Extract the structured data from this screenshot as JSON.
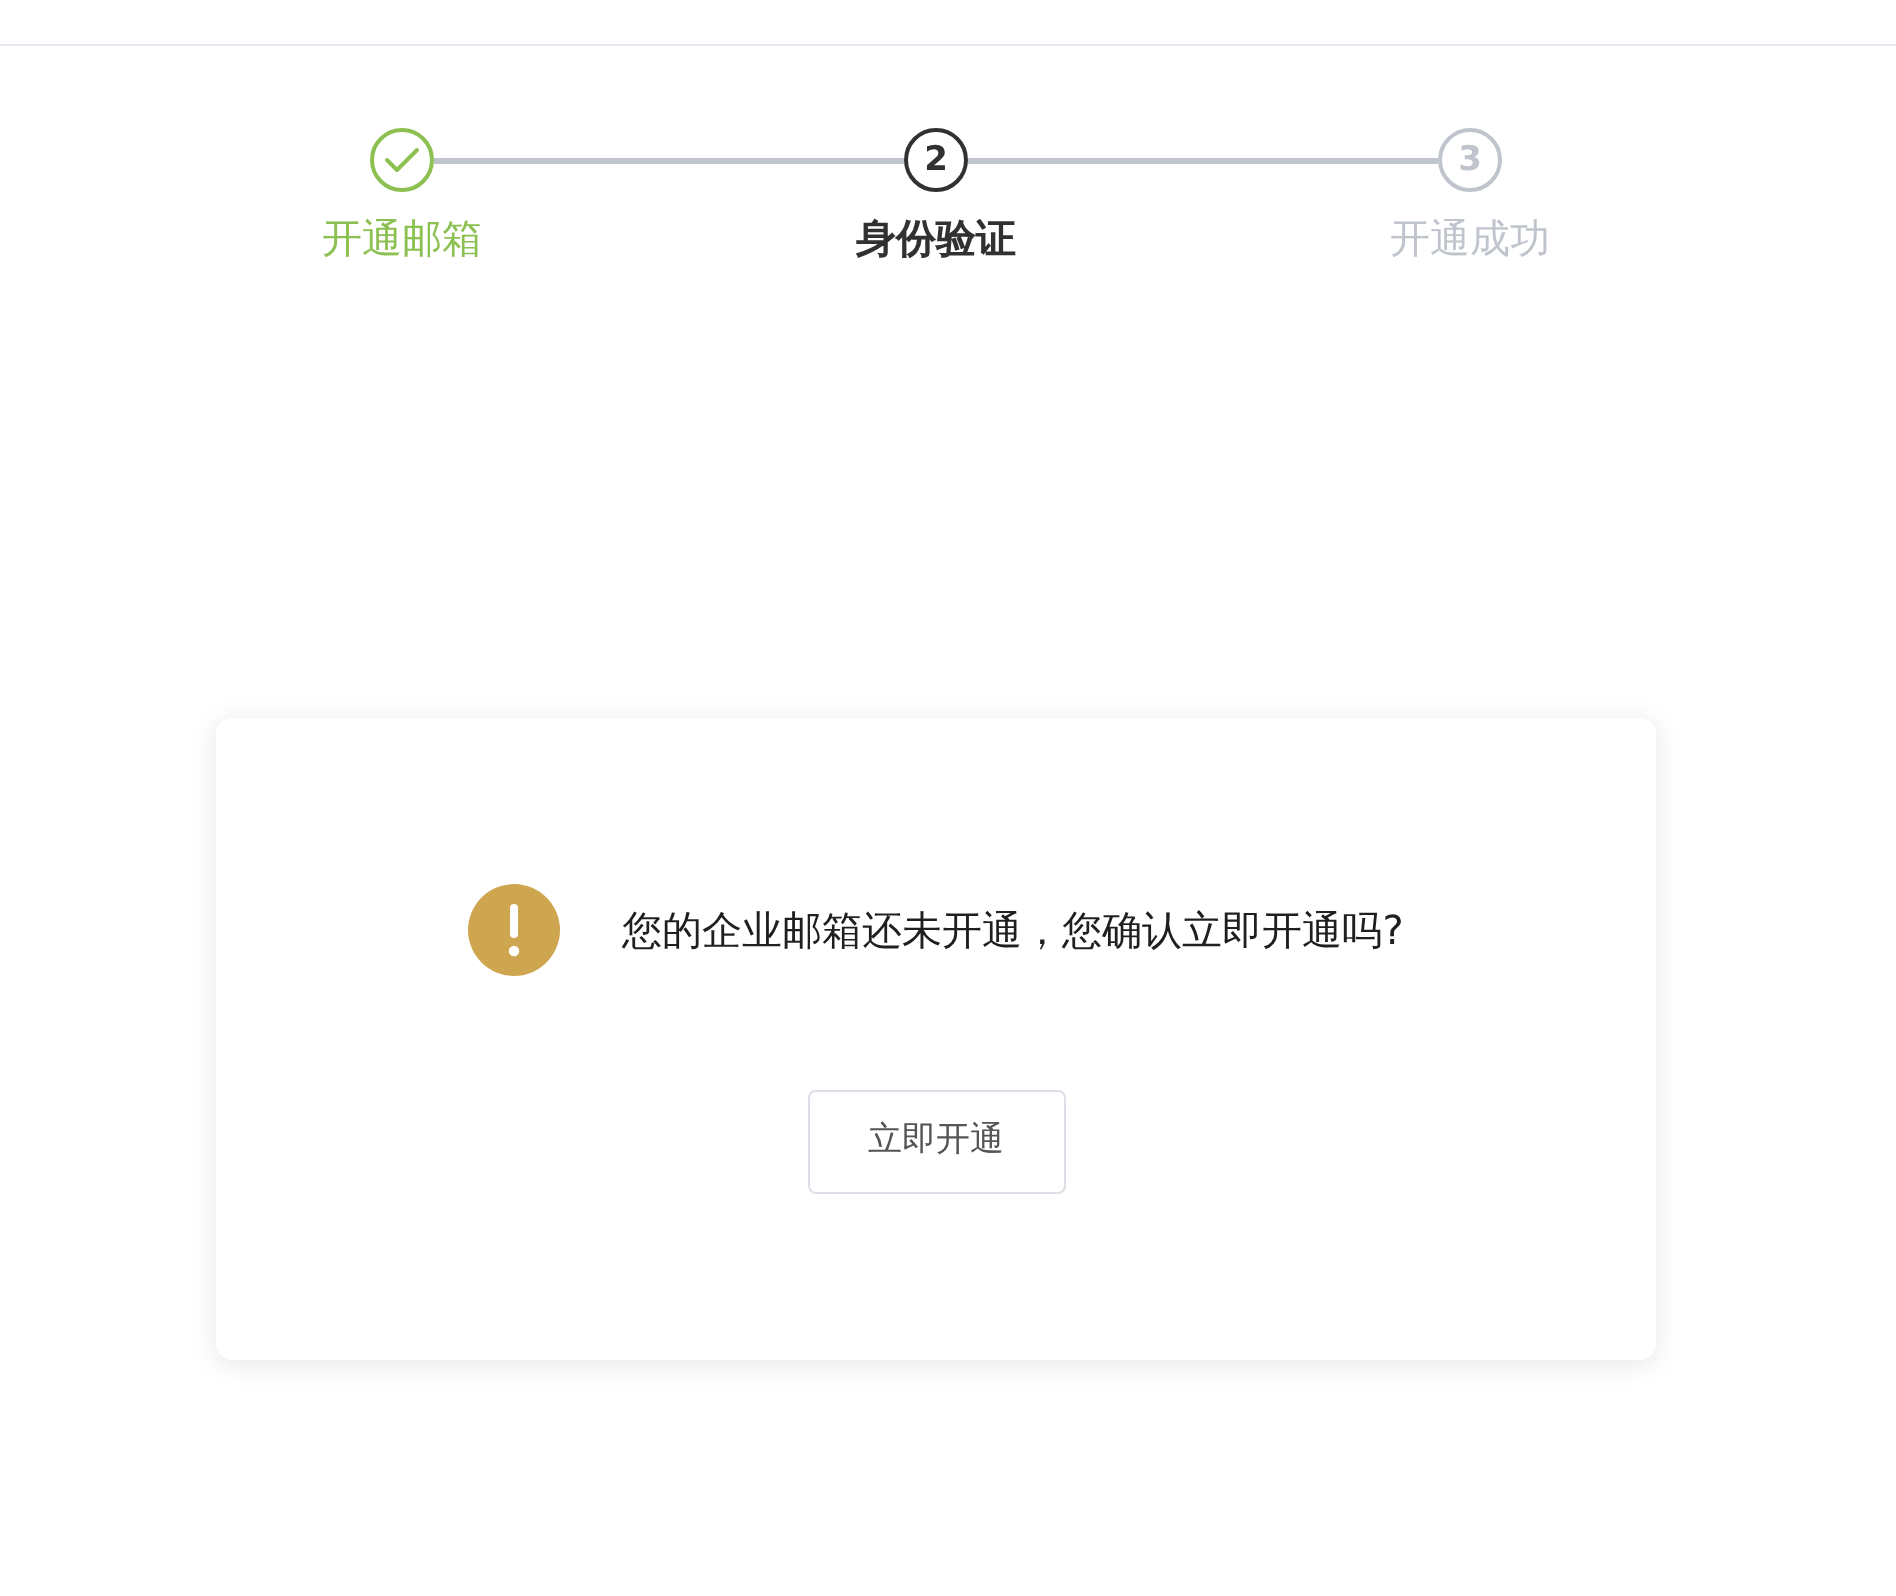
{
  "steps": [
    {
      "label": "开通邮箱",
      "completed": true,
      "selected": false
    },
    {
      "number": "2",
      "label": "身份验证",
      "completed": false,
      "selected": true
    },
    {
      "number": "3",
      "label": "开通成功",
      "completed": false,
      "selected": false
    }
  ],
  "dialog": {
    "message": "您的企业邮箱还未开通，您确认立即开通吗?",
    "button": "立即开通"
  }
}
